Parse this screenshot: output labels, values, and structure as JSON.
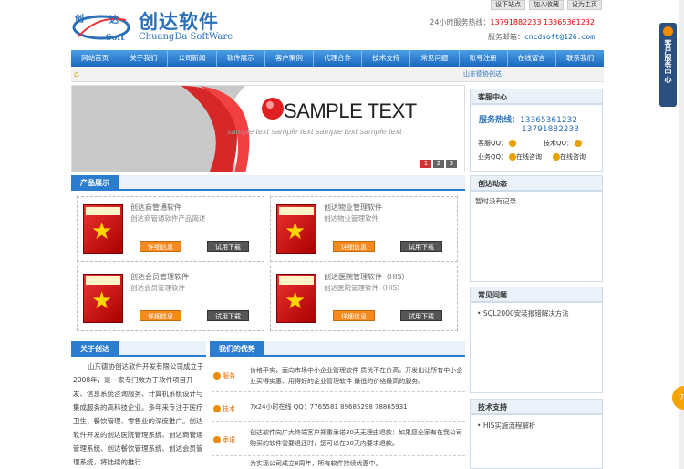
{
  "topbar": [
    "设下站点",
    "加入收藏",
    "设为主页"
  ],
  "logo": {
    "cn": "创达软件",
    "en": "ChuangDa SoftWare",
    "mark_text_a": "创",
    "mark_text_b": "达",
    "mark_text_c": "Soft"
  },
  "contact": {
    "hotline_label": "24小时服务热线：",
    "hotline_nums": "13791882233 13365361232",
    "email_label": "服务邮箱：",
    "email": "cncdsoft@126.com"
  },
  "nav": [
    "网站首页",
    "关于我们",
    "公司新闻",
    "软件展示",
    "客户案例",
    "代理合作",
    "技术支持",
    "常见问题",
    "账号注册",
    "在线留言",
    "联系我们"
  ],
  "crumb": {
    "marquee": "山东德协创达"
  },
  "banner": {
    "title": "SAMPLE TEXT",
    "subtitle": "sample text sample text sample text sample text",
    "pager": [
      "1",
      "2",
      "3"
    ]
  },
  "service": {
    "title": "客服中心",
    "hotline_label": "服务热线：",
    "num1": "13365361232",
    "num2": "13791882233",
    "qq_a": "客服QQ：",
    "qq_b": "技术QQ：",
    "biz": "业务QQ：",
    "online1": "在线咨询",
    "online2": "在线咨询"
  },
  "products": {
    "title": "产品展示",
    "items": [
      {
        "name": "创达商管通软件",
        "desc": "创达商管通软件产品简述",
        "detail": "详细信息",
        "trial": "试用下载"
      },
      {
        "name": "创达物业管理软件",
        "desc": "创达物业管理软件",
        "detail": "详细信息",
        "trial": "试用下载"
      },
      {
        "name": "创达会员管理软件",
        "desc": "创达会员管理软件",
        "detail": "详细信息",
        "trial": "试用下载"
      },
      {
        "name": "创达医院管理软件（HIS）",
        "desc": "创达医院管理软件（HIS）",
        "detail": "详细信息",
        "trial": "试用下载"
      }
    ]
  },
  "news": {
    "title": "创达动态",
    "empty": "暂时没有记录"
  },
  "faq": {
    "title": "常见问题",
    "items": [
      "SQL2000安装报错解决方法"
    ]
  },
  "tech": {
    "title": "技术支持",
    "items": [
      "HIS实施流程解析"
    ]
  },
  "about": {
    "title": "关于创达",
    "text": "山东德协创达软件开发有限公司成立于2008年，是一家专门致力于软件项目开发、信息系统咨询服务、计算机系统设计与集成服务的高科技企业。多年来专注于医疗卫生、餐饮管理、零售业的深度推广。创达软件开发的创达医院管理系统、创达商管通管理系统、创达餐饮管理系统、创达会员管理系统，将陆续的推行"
  },
  "advantages": {
    "title": "我们的优势",
    "rows": [
      {
        "tag": "服务",
        "text": "价格平实，面向市场中小企业管理软件 质优不在价高，开发出让所有中小企业买得实惠、用得好的企业管理软件 最低的价格最高的服务。"
      },
      {
        "tag": "技术",
        "text": "7x24小时在线 QQ：7765581   89685298   78865931"
      },
      {
        "tag": "承诺",
        "text": "创达软件向广大终端客户郑重承诺30天无理由退款：如果您全家有在我公司购买的软件需要退还时，您可以在30天内要求退款。"
      },
      {
        "tag": "",
        "text": "为实现公司成立8周年，所有软件持续优惠中。"
      }
    ]
  },
  "right_tab": {
    "label": "客户服务中心"
  },
  "float_bubble": "75",
  "colors": {
    "brand": "#2a7dcf",
    "accent": "#f58a1f"
  }
}
